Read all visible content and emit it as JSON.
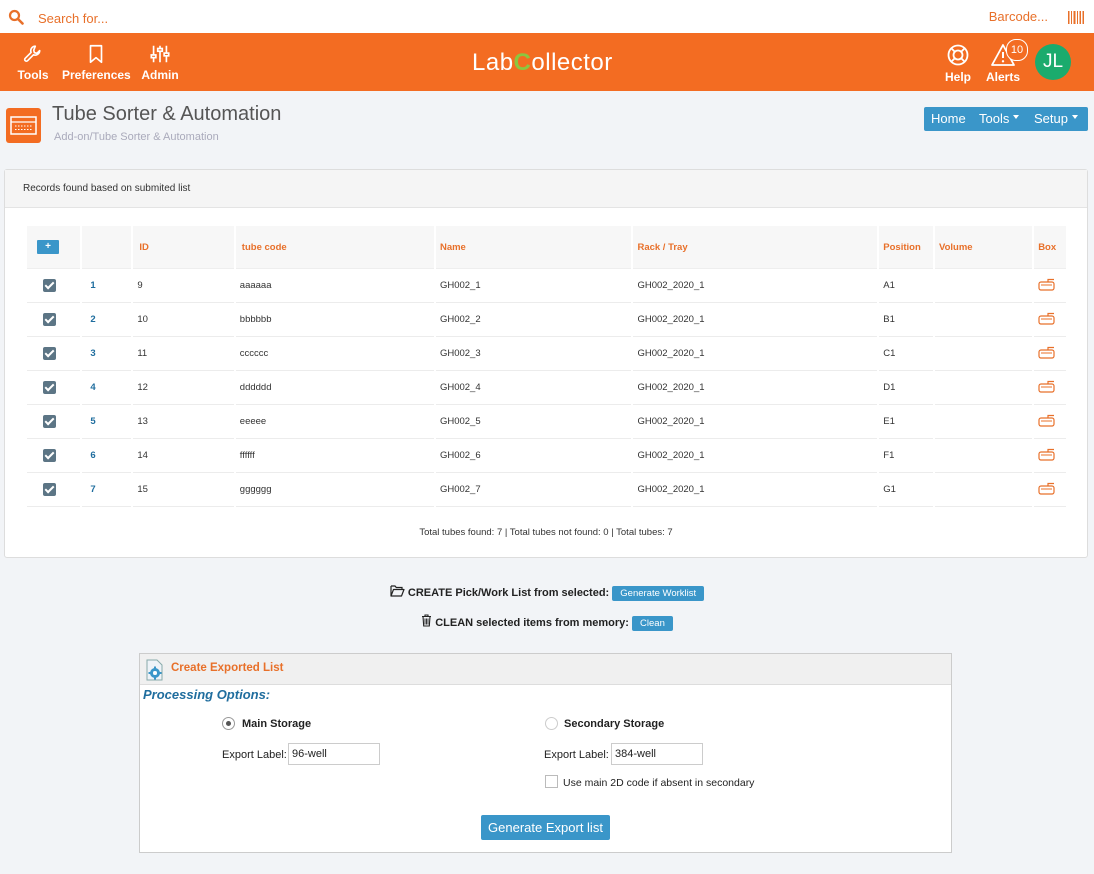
{
  "search": {
    "placeholder": "Search for...",
    "barcode_label": "Barcode..."
  },
  "topnav": {
    "left": [
      {
        "label": "Tools",
        "icon": "wrench-icon"
      },
      {
        "label": "Preferences",
        "icon": "bookmark-icon"
      },
      {
        "label": "Admin",
        "icon": "sliders-icon"
      }
    ],
    "logo_pre": "Lab",
    "logo_c": "C",
    "logo_post": "ollector",
    "right": [
      {
        "label": "Help",
        "icon": "lifebuoy-icon"
      },
      {
        "label": "Alerts",
        "icon": "alert-triangle-icon",
        "badge": "10"
      }
    ],
    "avatar": "JL"
  },
  "page": {
    "title": "Tube Sorter & Automation",
    "breadcrumb": "Add-on/Tube Sorter & Automation",
    "nav": {
      "home": "Home",
      "tools": "Tools",
      "setup": "Setup"
    }
  },
  "records": {
    "heading": "Records found based on submited list",
    "add_label": "+",
    "columns": [
      "ID",
      "tube code",
      "Name",
      "Rack / Tray",
      "Position",
      "Volume",
      "Box"
    ],
    "rows": [
      {
        "idx": "1",
        "id": "9",
        "code": "aaaaaa",
        "name": "GH002_1",
        "rack": "GH002_2020_1",
        "pos": "A1",
        "vol": ""
      },
      {
        "idx": "2",
        "id": "10",
        "code": "bbbbbb",
        "name": "GH002_2",
        "rack": "GH002_2020_1",
        "pos": "B1",
        "vol": ""
      },
      {
        "idx": "3",
        "id": "11",
        "code": "cccccc",
        "name": "GH002_3",
        "rack": "GH002_2020_1",
        "pos": "C1",
        "vol": ""
      },
      {
        "idx": "4",
        "id": "12",
        "code": "dddddd",
        "name": "GH002_4",
        "rack": "GH002_2020_1",
        "pos": "D1",
        "vol": ""
      },
      {
        "idx": "5",
        "id": "13",
        "code": "eeeee",
        "name": "GH002_5",
        "rack": "GH002_2020_1",
        "pos": "E1",
        "vol": ""
      },
      {
        "idx": "6",
        "id": "14",
        "code": "ffffff",
        "name": "GH002_6",
        "rack": "GH002_2020_1",
        "pos": "F1",
        "vol": ""
      },
      {
        "idx": "7",
        "id": "15",
        "code": "gggggg",
        "name": "GH002_7",
        "rack": "GH002_2020_1",
        "pos": "G1",
        "vol": ""
      }
    ],
    "totals": "Total tubes found: 7 | Total tubes not found: 0 | Total tubes: 7"
  },
  "actions": {
    "create_label": "CREATE Pick/Work List from selected:",
    "create_btn": "Generate Worklist",
    "clean_label": "CLEAN selected items from memory:",
    "clean_btn": "Clean"
  },
  "export": {
    "title": "Create Exported List",
    "processing": "Processing Options:",
    "main_label": "Main Storage",
    "secondary_label": "Secondary Storage",
    "export_label": "Export Label:",
    "main_value": "96-well",
    "secondary_value": "384-well",
    "checkbox_label": "Use main 2D code if absent in secondary",
    "button": "Generate Export list"
  },
  "colors": {
    "brand": "#f36c22",
    "accent": "#3a96c9",
    "avatar": "#1bab6d"
  }
}
